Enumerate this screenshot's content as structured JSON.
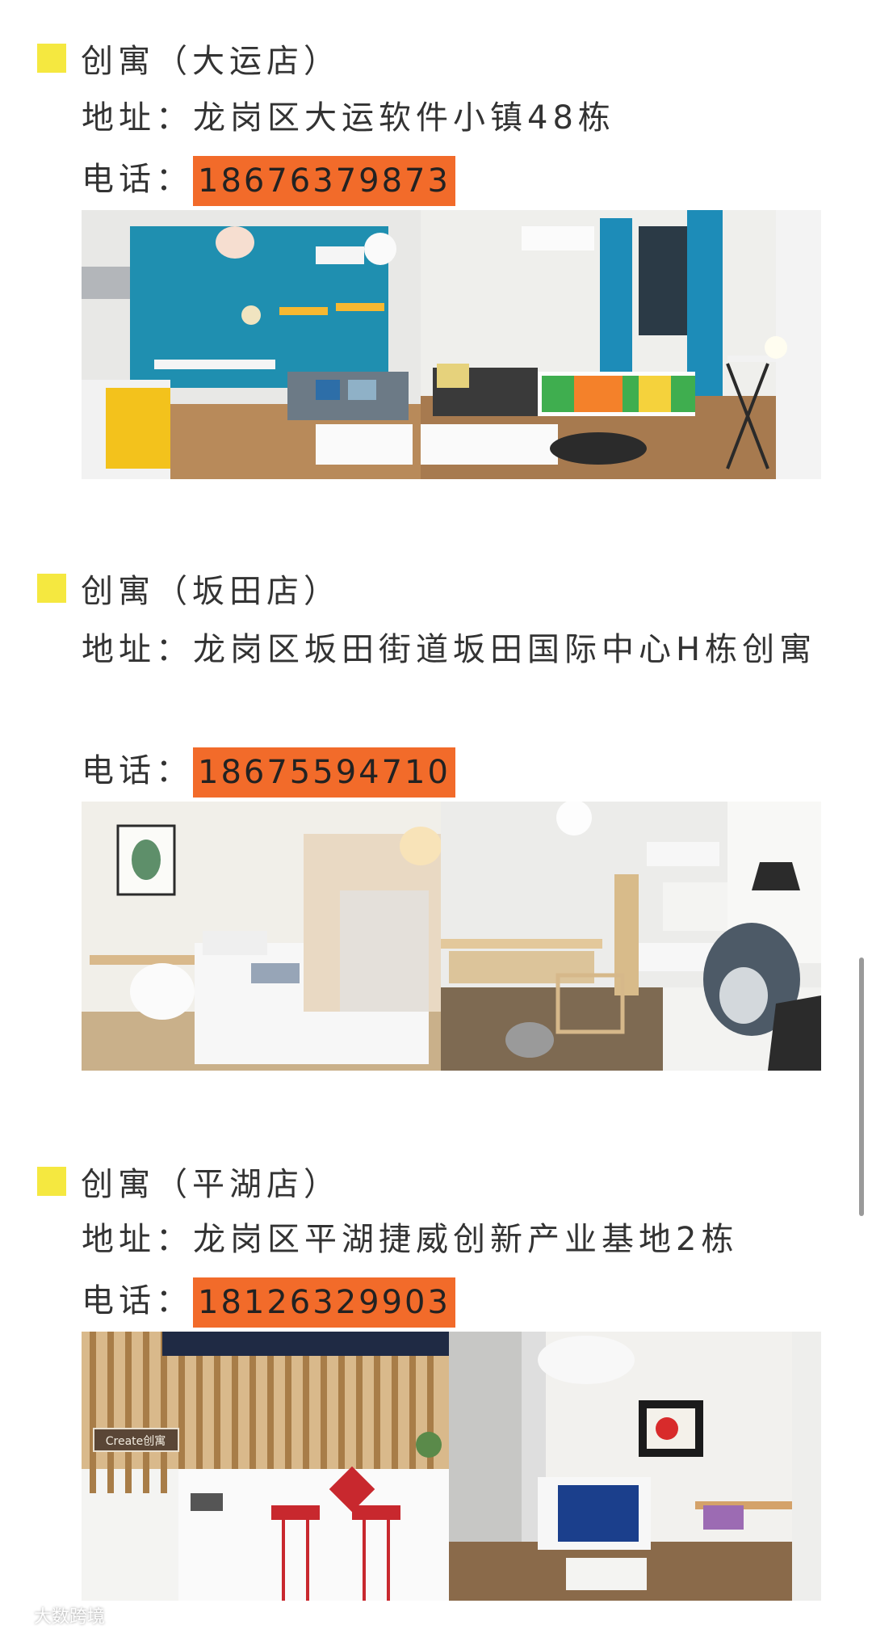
{
  "stores": [
    {
      "title": "创寓（大运店）",
      "address_label": "地址：",
      "address": "龙岗区大运软件小镇48栋",
      "phone_label": "电话：",
      "phone": "18676379873"
    },
    {
      "title": "创寓（坂田店）",
      "address_label": "地址：",
      "address": "龙岗区坂田街道坂田国际中心H栋创寓",
      "phone_label": "电话：",
      "phone": "18675594710"
    },
    {
      "title": "创寓（平湖店）",
      "address_label": "地址：",
      "address": "龙岗区平湖捷威创新产业基地2栋",
      "phone_label": "电话：",
      "phone": "18126329903"
    }
  ],
  "photo3_sign": "Create创寓",
  "watermark": "大数跨境",
  "colors": {
    "bullet": "#f5e840",
    "phone_highlight": "#f26b2a"
  }
}
